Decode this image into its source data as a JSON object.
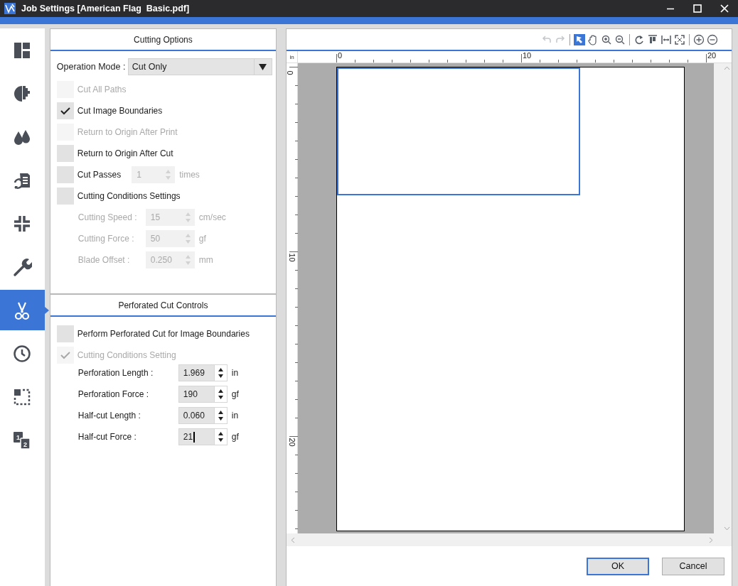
{
  "window": {
    "title": "Job Settings [American Flag  Basic.pdf]"
  },
  "sidebar": {
    "items": [
      {
        "selected": false
      },
      {
        "selected": false
      },
      {
        "selected": false
      },
      {
        "selected": false
      },
      {
        "selected": false
      },
      {
        "selected": false
      },
      {
        "selected": true
      },
      {
        "selected": false
      },
      {
        "selected": false
      },
      {
        "selected": false,
        "glyphs": [
          "1",
          "2"
        ]
      }
    ]
  },
  "cutting_options": {
    "title": "Cutting Options",
    "operation_mode": {
      "label": "Operation Mode :",
      "value": "Cut Only"
    },
    "options": [
      {
        "kind": "check",
        "label": "Cut All Paths",
        "checked": false,
        "disabled": true
      },
      {
        "kind": "check",
        "label": "Cut Image Boundaries",
        "checked": true,
        "disabled": false
      },
      {
        "kind": "check",
        "label": "Return to Origin After Print",
        "checked": false,
        "disabled": true
      },
      {
        "kind": "check",
        "label": "Return to Origin After Cut",
        "checked": false,
        "disabled": false
      },
      {
        "kind": "passes",
        "label": "Cut Passes",
        "checked": false,
        "disabled": false,
        "value": "1",
        "unit": "times",
        "field_disabled": true
      },
      {
        "kind": "check",
        "label": "Cutting Conditions Settings",
        "checked": false,
        "disabled": false
      }
    ],
    "params": [
      {
        "label": "Cutting Speed :",
        "value": "15",
        "unit": "cm/sec",
        "disabled": true,
        "focused": false
      },
      {
        "label": "Cutting Force :",
        "value": "50",
        "unit": "gf",
        "disabled": true,
        "focused": false
      },
      {
        "label": "Blade Offset :",
        "value": "0.250",
        "unit": "mm",
        "disabled": true,
        "focused": false
      }
    ]
  },
  "perforated_cut": {
    "title": "Perforated Cut Controls",
    "options": [
      {
        "kind": "check",
        "label": "Perform Perforated Cut for Image Boundaries",
        "checked": false,
        "disabled": false
      },
      {
        "kind": "check",
        "label": "Cutting Conditions Setting",
        "checked": true,
        "disabled": true
      }
    ],
    "params": [
      {
        "label": "Perforation Length :",
        "value": "1.969",
        "unit": "in",
        "disabled": false,
        "focused": false
      },
      {
        "label": "Perforation Force :",
        "value": "190",
        "unit": "gf",
        "disabled": false,
        "focused": false
      },
      {
        "label": "Half-cut Length :",
        "value": "0.060",
        "unit": "in",
        "disabled": false,
        "focused": false
      },
      {
        "label": "Half-cut Force :",
        "value": "21",
        "unit": "gf",
        "disabled": false,
        "focused": true
      }
    ]
  },
  "toolbar": {
    "groups": [
      [
        {
          "disabled": true,
          "selected": false
        },
        {
          "disabled": true,
          "selected": false
        }
      ],
      [
        {
          "disabled": false,
          "selected": true
        },
        {
          "disabled": false,
          "selected": false
        },
        {
          "disabled": false,
          "selected": false
        },
        {
          "disabled": false,
          "selected": false
        }
      ],
      [
        {
          "disabled": false,
          "selected": false
        },
        {
          "disabled": false,
          "selected": false
        },
        {
          "disabled": false,
          "selected": false
        },
        {
          "disabled": false,
          "selected": false
        }
      ],
      [
        {
          "disabled": false,
          "selected": false
        },
        {
          "disabled": false,
          "selected": false
        }
      ]
    ]
  },
  "canvas": {
    "ruler": {
      "unit": "in",
      "x_labels": [
        "0",
        "10",
        "20"
      ],
      "y_labels": [
        "0",
        "10",
        "20"
      ]
    }
  },
  "buttons": [
    {
      "label": "OK",
      "default": true
    },
    {
      "label": "Cancel",
      "default": false
    }
  ]
}
